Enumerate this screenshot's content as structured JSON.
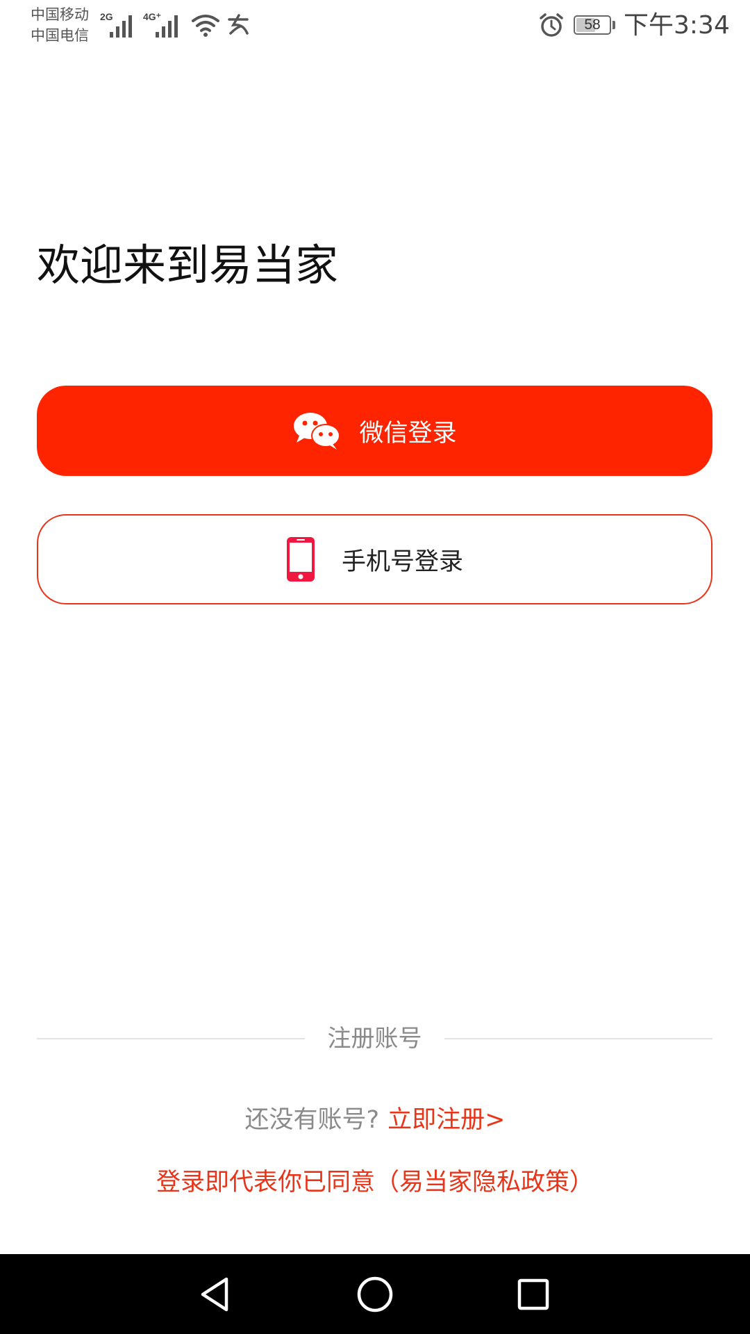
{
  "status_bar": {
    "carrier_1": "中国移动",
    "carrier_2": "中国电信",
    "signal_1_label": "2G",
    "signal_2_label": "4G⁺",
    "battery_level": "58",
    "battery_fraction": 0.58,
    "time": "下午3:34",
    "icons": [
      "signal-icon",
      "signal-icon",
      "wifi-icon",
      "network-speed-icon",
      "alarm-icon",
      "battery-icon"
    ]
  },
  "main": {
    "welcome_title": "欢迎来到易当家",
    "wechat_login_label": "微信登录",
    "phone_login_label": "手机号登录"
  },
  "register": {
    "section_title": "注册账号",
    "no_account_text": "还没有账号?",
    "register_link": "立即注册>",
    "privacy_text": "登录即代表你已同意（易当家隐私政策）"
  },
  "nav_bar": {
    "icons": [
      "back-icon",
      "home-icon",
      "recent-apps-icon"
    ]
  },
  "colors": {
    "accent": "#ff2400",
    "link_red": "#e8351a",
    "phone_icon": "#f01840",
    "muted_text": "#8a8a8a"
  }
}
